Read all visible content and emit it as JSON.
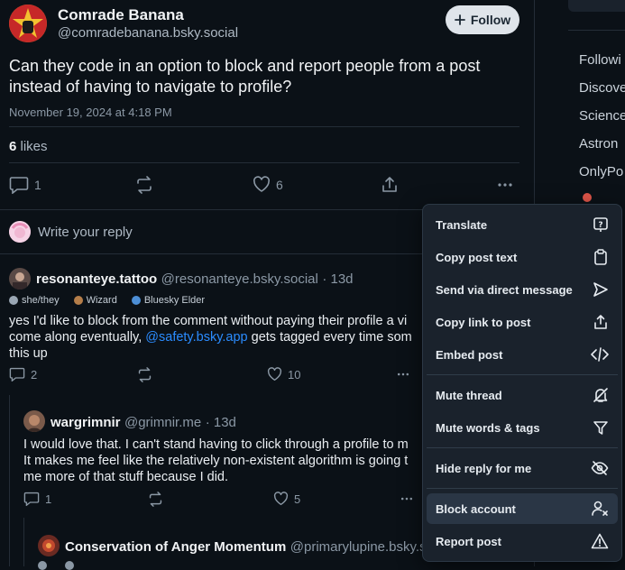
{
  "post": {
    "author_name": "Comrade Banana",
    "author_handle": "@comradebanana.bsky.social",
    "follow_label": "Follow",
    "text": "Can they code in an option to block and report people from a post instead of having to navigate to profile?",
    "date": "November 19, 2024 at 4:18 PM",
    "likes_count": "6",
    "likes_label": "likes",
    "reply_count": "1",
    "like_count": "6",
    "reply_placeholder": "Write your reply"
  },
  "replies": [
    {
      "name": "resonanteye.tattoo",
      "handle": "@resonanteye.bsky.social",
      "time": "· 13d",
      "badges": [
        "she/they",
        "Wizard",
        "Bluesky Elder"
      ],
      "text_1": "yes I'd like to block from the comment without paying their profile a vi",
      "text_2a": "come along eventually, ",
      "mention": "@safety.bsky.app",
      "text_2b": " gets tagged every time som",
      "text_3": "this up",
      "reply_count": "2",
      "like_count": "10"
    },
    {
      "name": "wargrimnir",
      "handle": "@grimnir.me",
      "time": "· 13d",
      "text_1": "I would love that. I can't stand having to click through a profile to m",
      "text_2": "It makes me feel like the relatively non-existent algorithm is going t",
      "text_3": "me more of that stuff because I did.",
      "reply_count": "1",
      "like_count": "5"
    },
    {
      "name": "Conservation of Anger Momentum",
      "handle": "@primarylupine.bsky.so"
    }
  ],
  "sidebar": {
    "items": [
      "Followi",
      "Discove",
      "Science",
      "Astron",
      "OnlyPo"
    ]
  },
  "menu": {
    "items": [
      {
        "label": "Translate",
        "icon": "translate-icon"
      },
      {
        "label": "Copy post text",
        "icon": "clipboard-icon"
      },
      {
        "label": "Send via direct message",
        "icon": "send-icon"
      },
      {
        "label": "Copy link to post",
        "icon": "share-icon"
      },
      {
        "label": "Embed post",
        "icon": "code-icon"
      },
      {
        "label": "Mute thread",
        "icon": "mute-icon"
      },
      {
        "label": "Mute words & tags",
        "icon": "filter-icon"
      },
      {
        "label": "Hide reply for me",
        "icon": "eye-slash-icon"
      },
      {
        "label": "Block account",
        "icon": "person-x-icon"
      },
      {
        "label": "Report post",
        "icon": "warning-icon"
      }
    ]
  },
  "colors": {
    "background": "#0b1117",
    "accent_link": "#2b8cff",
    "menu_bg": "#1a222c",
    "menu_highlight": "#2a3645"
  }
}
